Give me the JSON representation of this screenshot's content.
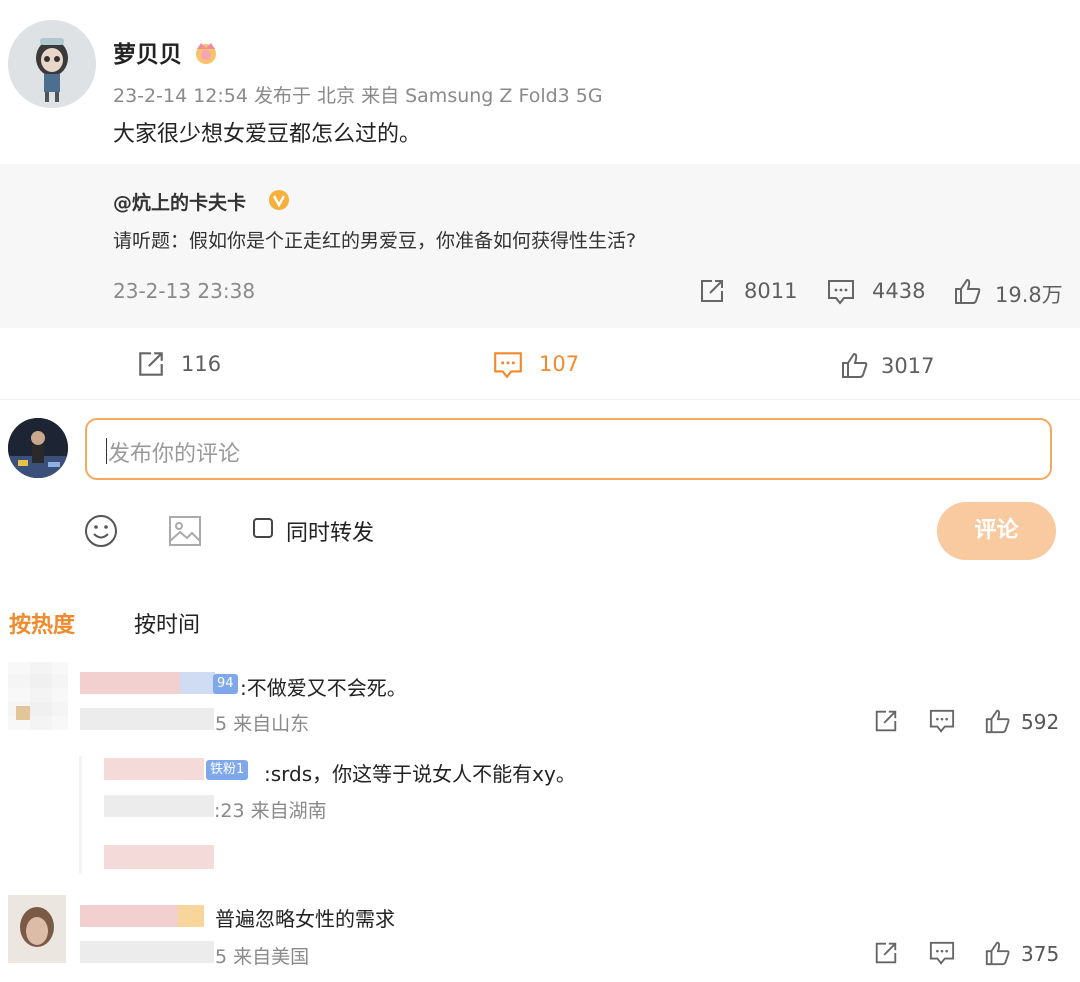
{
  "post": {
    "author": "萝贝贝",
    "meta": "23-2-14 12:54 发布于 北京 来自 Samsung Z Fold3 5G",
    "text": "大家很少想女爱豆都怎么过的。"
  },
  "quoted": {
    "author": "@炕上的卡夫卡",
    "text": "请听题：假如你是个正走红的男爱豆，你准备如何获得性生活?",
    "date": "23-2-13 23:38",
    "reposts": "8011",
    "comments": "4438",
    "likes": "19.8万"
  },
  "actions": {
    "reposts": "116",
    "comments": "107",
    "likes": "3017"
  },
  "compose": {
    "placeholder": "发布你的评论",
    "repost_label": "同时转发",
    "submit_label": "评论"
  },
  "sort": {
    "hot": "按热度",
    "time": "按时间"
  },
  "comments": [
    {
      "badge": "94",
      "text": ":不做爱又不会死。",
      "meta": "5 来自山东",
      "likes": "592",
      "reply": {
        "badge": "铁粉1",
        "text": ":srds，你这等于说女人不能有xy。",
        "meta": ":23 来自湖南"
      }
    },
    {
      "text": "普遍忽略女性的需求",
      "meta": "5 来自美国",
      "likes": "375"
    }
  ],
  "colors": {
    "accent": "#f18a2c",
    "quote_bg": "#f7f7f7",
    "submit_bg": "#f9c9a0"
  }
}
